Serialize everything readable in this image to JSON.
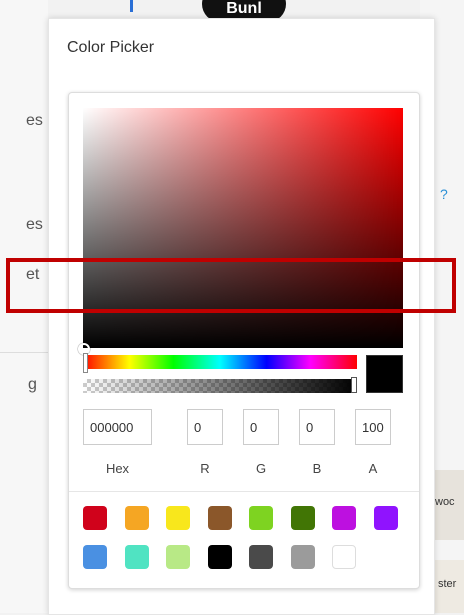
{
  "background": {
    "left_fragments": [
      "es",
      "es",
      "et",
      "g"
    ],
    "pill_text": "Bunl",
    "help_glyph": "?",
    "map_labels": [
      "woc",
      "ster"
    ]
  },
  "color_picker": {
    "title": "Color Picker",
    "current_color": "#000000",
    "hue_base": "#ff0000",
    "fields": {
      "hex": "000000",
      "r": "0",
      "g": "0",
      "b": "0",
      "a": "100"
    },
    "labels": {
      "hex": "Hex",
      "r": "R",
      "g": "G",
      "b": "B",
      "a": "A"
    },
    "swatches": [
      "#d0021b",
      "#f5a623",
      "#f8e71c",
      "#8b572a",
      "#7ed321",
      "#417505",
      "#bd10e0",
      "#9013fe",
      "#4a90e2",
      "#50e3c2",
      "#b8e986",
      "#000000",
      "#4a4a4a",
      "#9b9b9b",
      "#ffffff"
    ]
  },
  "highlight_color": "#c00000"
}
